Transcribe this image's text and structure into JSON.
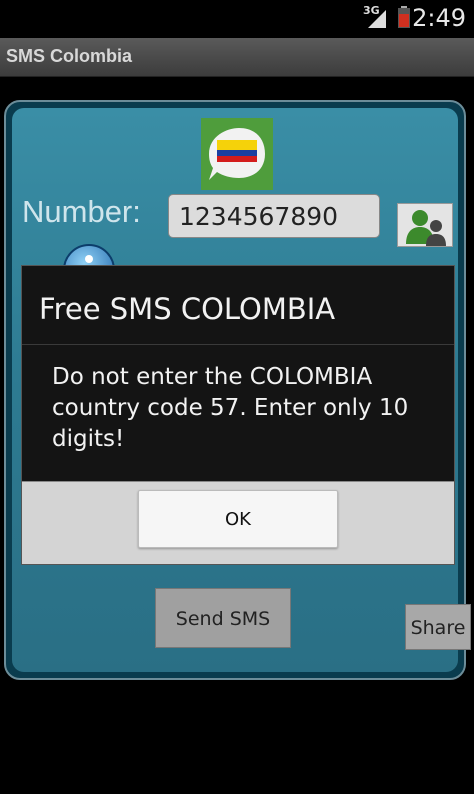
{
  "status_bar": {
    "network": "3G",
    "time": "2:49"
  },
  "app": {
    "title": "SMS Colombia"
  },
  "form": {
    "number_label": "Number:",
    "number_value": "1234567890",
    "send_label": "Send SMS",
    "share_label": "Share"
  },
  "dialog": {
    "title": "Free SMS COLOMBIA",
    "message": "Do not enter the COLOMBIA country code 57.  Enter only 10 digits!",
    "ok_label": "OK"
  },
  "colors": {
    "panel": "#2d7a91",
    "dialog_bg": "#141414",
    "button_bar": "#d4d4d4"
  }
}
